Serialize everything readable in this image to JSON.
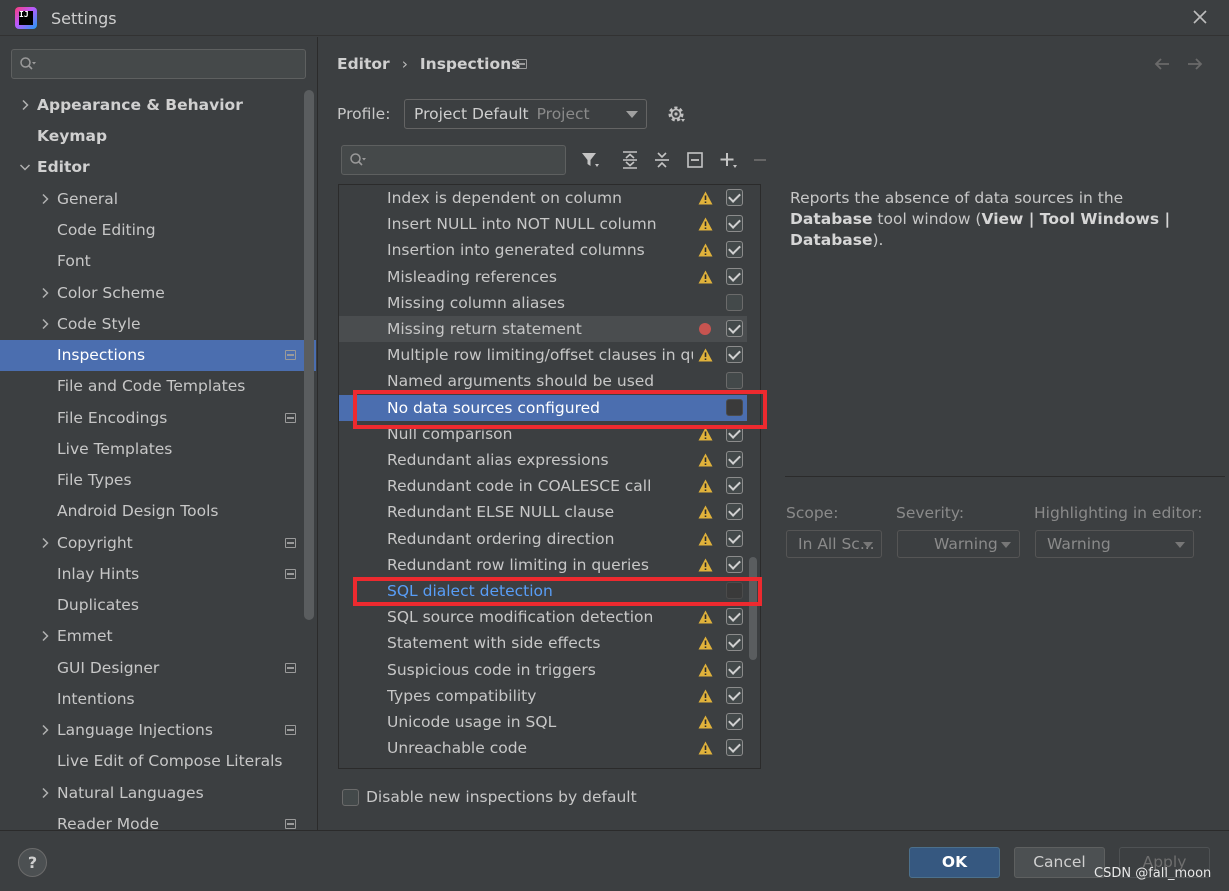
{
  "window": {
    "title": "Settings",
    "app_icon_text": "IJ"
  },
  "sidebar": {
    "search_placeholder": "",
    "items": [
      {
        "label": "Appearance & Behavior",
        "expandable": true
      },
      {
        "label": "Keymap"
      },
      {
        "label": "Editor",
        "expanded": true
      },
      {
        "label": "General",
        "expandable": true
      },
      {
        "label": "Code Editing"
      },
      {
        "label": "Font"
      },
      {
        "label": "Color Scheme",
        "expandable": true
      },
      {
        "label": "Code Style",
        "expandable": true
      },
      {
        "label": "Inspections",
        "selected": true
      },
      {
        "label": "File and Code Templates"
      },
      {
        "label": "File Encodings"
      },
      {
        "label": "Live Templates"
      },
      {
        "label": "File Types"
      },
      {
        "label": "Android Design Tools"
      },
      {
        "label": "Copyright",
        "expandable": true
      },
      {
        "label": "Inlay Hints"
      },
      {
        "label": "Duplicates"
      },
      {
        "label": "Emmet",
        "expandable": true
      },
      {
        "label": "GUI Designer"
      },
      {
        "label": "Intentions"
      },
      {
        "label": "Language Injections",
        "expandable": true
      },
      {
        "label": "Live Edit of Compose Literals"
      },
      {
        "label": "Natural Languages",
        "expandable": true
      },
      {
        "label": "Reader Mode"
      }
    ]
  },
  "breadcrumb": {
    "parent": "Editor",
    "separator": "›",
    "current": "Inspections"
  },
  "profile": {
    "label": "Profile:",
    "value": "Project Default",
    "scope": "Project"
  },
  "inspections": [
    {
      "name": "Index is dependent on column",
      "severity": "warning",
      "checked": true
    },
    {
      "name": "Insert NULL into NOT NULL column",
      "severity": "warning",
      "checked": true
    },
    {
      "name": "Insertion into generated columns",
      "severity": "warning",
      "checked": true
    },
    {
      "name": "Misleading references",
      "severity": "warning",
      "checked": true
    },
    {
      "name": "Missing column aliases",
      "severity": "none",
      "checked": false
    },
    {
      "name": "Missing return statement",
      "severity": "error",
      "checked": true
    },
    {
      "name": "Multiple row limiting/offset clauses in que",
      "severity": "warning",
      "checked": true
    },
    {
      "name": "Named arguments should be used",
      "severity": "none",
      "checked": false
    },
    {
      "name": "No data sources configured",
      "severity": "none",
      "checked": false
    },
    {
      "name": "Null comparison",
      "severity": "warning",
      "checked": true
    },
    {
      "name": "Redundant alias expressions",
      "severity": "warning",
      "checked": true
    },
    {
      "name": "Redundant code in COALESCE call",
      "severity": "warning",
      "checked": true
    },
    {
      "name": "Redundant ELSE NULL clause",
      "severity": "warning",
      "checked": true
    },
    {
      "name": "Redundant ordering direction",
      "severity": "warning",
      "checked": true
    },
    {
      "name": "Redundant row limiting in queries",
      "severity": "warning",
      "checked": true
    },
    {
      "name": "SQL dialect detection",
      "severity": "none",
      "checked": false
    },
    {
      "name": "SQL source modification detection",
      "severity": "warning",
      "checked": true
    },
    {
      "name": "Statement with side effects",
      "severity": "warning",
      "checked": true
    },
    {
      "name": "Suspicious code in triggers",
      "severity": "warning",
      "checked": true
    },
    {
      "name": "Types compatibility",
      "severity": "warning",
      "checked": true
    },
    {
      "name": "Unicode usage in SQL",
      "severity": "warning",
      "checked": true
    },
    {
      "name": "Unreachable code",
      "severity": "warning",
      "checked": true
    }
  ],
  "description": {
    "part1": "Reports the absence of data sources in the ",
    "bold1": "Database",
    "part2": " tool window (",
    "bold2": "View | Tool Windows | Database",
    "part3": ")."
  },
  "options": {
    "scope_label": "Scope:",
    "scope_value": "In All Sc...",
    "severity_label": "Severity:",
    "severity_value": "Warning",
    "highlight_label": "Highlighting in editor:",
    "highlight_value": "Warning"
  },
  "disable_label": "Disable new inspections by default",
  "buttons": {
    "help": "?",
    "ok": "OK",
    "cancel": "Cancel",
    "apply": "Apply"
  },
  "watermark": "CSDN @fall_moon",
  "colors": {
    "accent": "#4b6eaf",
    "link": "#589df6",
    "warning": "#e0b23b",
    "error": "#c75450",
    "annotation": "#ed2a2f"
  }
}
